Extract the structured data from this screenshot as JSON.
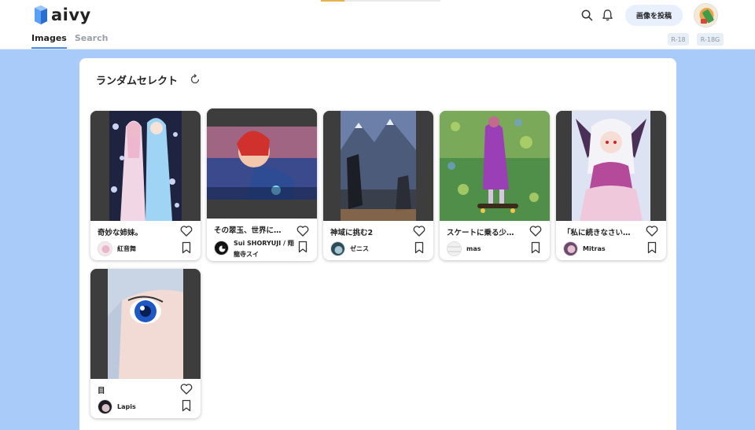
{
  "app": {
    "logo_text": "aivy"
  },
  "header": {
    "tabs": [
      {
        "label": "Images",
        "active": true
      },
      {
        "label": "Search",
        "active": false
      }
    ],
    "post_button_label": "画像を投稿",
    "ratings": [
      "R-18",
      "R-18G"
    ],
    "accent_color": "#4a8de8",
    "progress": 0.2
  },
  "main": {
    "title": "ランダムセレクト",
    "cards": [
      {
        "title": "奇妙な姉妹。",
        "author": "紅音舞"
      },
      {
        "title": "その翠玉、世界に…",
        "author": "Sui SHORYUJI / 翔龍寺スイ"
      },
      {
        "title": "神域に挑む2",
        "author": "ゼニス"
      },
      {
        "title": "スケートに乗る少…",
        "author": "mas"
      },
      {
        "title": "「私に続きなさい…",
        "author": "Mitras"
      },
      {
        "title": "目",
        "author": "Lapis"
      }
    ]
  },
  "colors": {
    "page_background": "#a9cbfa",
    "post_button_bg": "#e8f0fd"
  }
}
